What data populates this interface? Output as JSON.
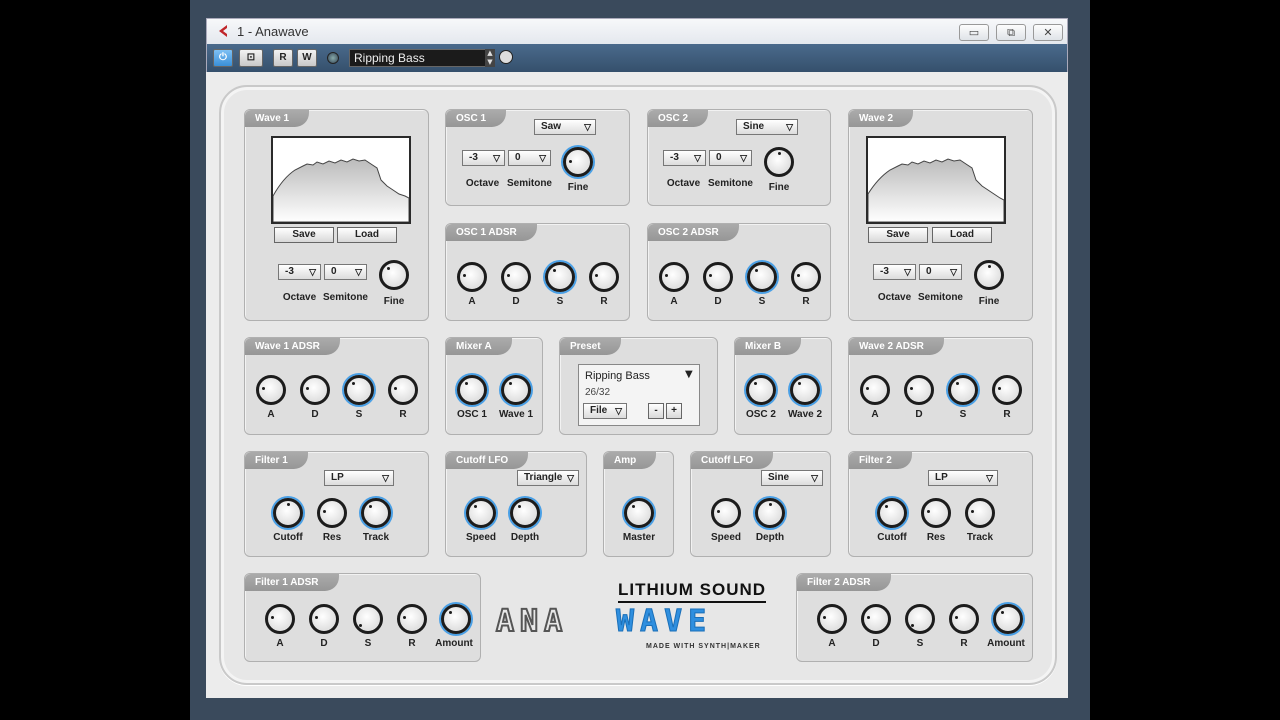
{
  "window": {
    "title": "1 - Anawave",
    "min": "▭",
    "restore": "⧉",
    "close": "✕"
  },
  "toolbar": {
    "r": "R",
    "w": "W",
    "preset": "Ripping Bass",
    "power": "⏻",
    "rec": "⊡"
  },
  "wave1": {
    "title": "Wave 1",
    "save": "Save",
    "load": "Load",
    "octave": "-3",
    "semitone": "0",
    "lbl_octave": "Octave",
    "lbl_semitone": "Semitone",
    "lbl_fine": "Fine"
  },
  "wave2": {
    "title": "Wave 2",
    "save": "Save",
    "load": "Load",
    "octave": "-3",
    "semitone": "0",
    "lbl_octave": "Octave",
    "lbl_semitone": "Semitone",
    "lbl_fine": "Fine"
  },
  "osc1": {
    "title": "OSC 1",
    "shape": "Saw",
    "octave": "-3",
    "semitone": "0",
    "lbl_octave": "Octave",
    "lbl_semitone": "Semitone",
    "lbl_fine": "Fine"
  },
  "osc2": {
    "title": "OSC 2",
    "shape": "Sine",
    "octave": "-3",
    "semitone": "0",
    "lbl_octave": "Octave",
    "lbl_semitone": "Semitone",
    "lbl_fine": "Fine"
  },
  "osc1adsr": {
    "title": "OSC 1 ADSR",
    "a": "A",
    "d": "D",
    "s": "S",
    "r": "R"
  },
  "osc2adsr": {
    "title": "OSC 2 ADSR",
    "a": "A",
    "d": "D",
    "s": "S",
    "r": "R"
  },
  "wave1adsr": {
    "title": "Wave 1 ADSR",
    "a": "A",
    "d": "D",
    "s": "S",
    "r": "R"
  },
  "wave2adsr": {
    "title": "Wave 2 ADSR",
    "a": "A",
    "d": "D",
    "s": "S",
    "r": "R"
  },
  "mixerA": {
    "title": "Mixer A",
    "k1": "OSC 1",
    "k2": "Wave 1"
  },
  "mixerB": {
    "title": "Mixer B",
    "k1": "OSC 2",
    "k2": "Wave 2"
  },
  "preset": {
    "title": "Preset",
    "name": "Ripping Bass",
    "count": "26/32",
    "file": "File",
    "minus": "-",
    "plus": "+"
  },
  "filter1": {
    "title": "Filter 1",
    "type": "LP",
    "cutoff": "Cutoff",
    "res": "Res",
    "track": "Track"
  },
  "filter2": {
    "title": "Filter 2",
    "type": "LP",
    "cutoff": "Cutoff",
    "res": "Res",
    "track": "Track"
  },
  "lfo1": {
    "title": "Cutoff LFO",
    "shape": "Triangle",
    "speed": "Speed",
    "depth": "Depth"
  },
  "lfo2": {
    "title": "Cutoff LFO",
    "shape": "Sine",
    "speed": "Speed",
    "depth": "Depth"
  },
  "amp": {
    "title": "Amp",
    "master": "Master"
  },
  "filter1adsr": {
    "title": "Filter 1 ADSR",
    "a": "A",
    "d": "D",
    "s": "S",
    "r": "R",
    "amount": "Amount"
  },
  "filter2adsr": {
    "title": "Filter 2 ADSR",
    "a": "A",
    "d": "D",
    "s": "S",
    "r": "R",
    "amount": "Amount"
  },
  "brand": {
    "company": "LITHIUM SOUND",
    "ana": "ANA",
    "wave": "WAVE",
    "tagline": "MADE WITH SYNTH|MAKER"
  },
  "colors": {
    "accent": "#2f8fdf",
    "panel": "#dedede",
    "title_tab": "#9c9c9c"
  }
}
